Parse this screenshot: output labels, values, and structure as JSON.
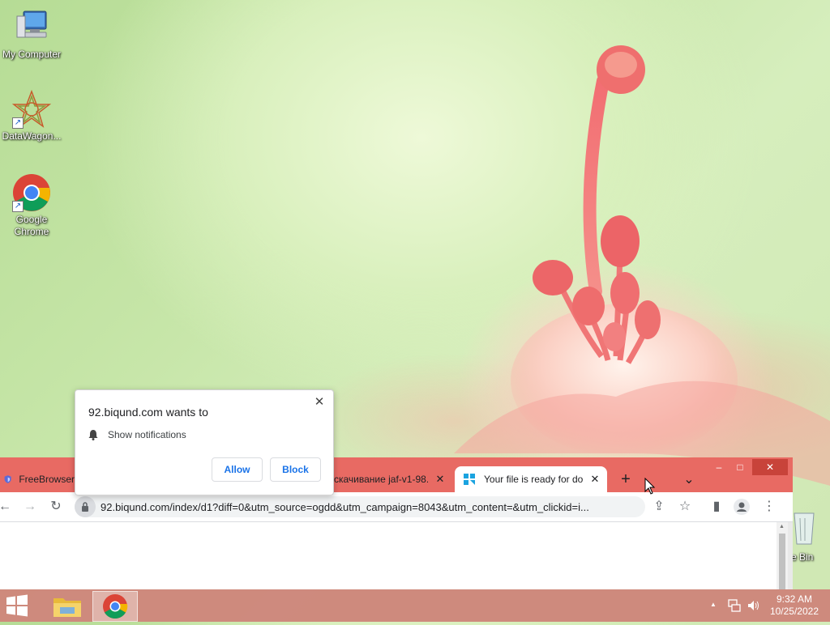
{
  "desktop": {
    "icons": [
      {
        "label": "My Computer",
        "icon": "computer-icon"
      },
      {
        "label": "DataWagon...",
        "icon": "datawagon-icon"
      },
      {
        "label": "Google Chrome",
        "icon": "chrome-icon"
      }
    ],
    "recycle_bin_partial_label": "e Bin"
  },
  "permission_popup": {
    "title": "92.biqund.com wants to",
    "request": "Show notifications",
    "allow_label": "Allow",
    "block_label": "Block",
    "close_glyph": "✕"
  },
  "browser": {
    "tabs": [
      {
        "title": "FreeBrowser",
        "icon": "shield-icon",
        "active": false
      },
      {
        "title": "скачивание jaf-v1-98.",
        "icon": null,
        "active": false
      },
      {
        "title": "Your file is ready for do",
        "icon": "file-icon",
        "active": true
      }
    ],
    "new_tab_glyph": "+",
    "tab_search_glyph": "⌄",
    "window_controls": {
      "minimize": "–",
      "maximize": "□",
      "close": "✕"
    },
    "url": "92.biqund.com/index/d1?diff=0&utm_source=ogdd&utm_campaign=8043&utm_content=&utm_clickid=i...",
    "nav": {
      "back": "←",
      "forward": "→",
      "reload": "↻"
    }
  },
  "taskbar": {
    "apps": [
      {
        "name": "file-explorer",
        "active": false
      },
      {
        "name": "chrome",
        "active": true
      }
    ],
    "clock": {
      "time": "9:32 AM",
      "date": "10/25/2022"
    },
    "tray_glyphs": {
      "expand": "▲",
      "network": "🖧",
      "volume": "🔊"
    }
  },
  "colors": {
    "accent_tabstrip": "#e86a63",
    "taskbar": "#cd8278",
    "link_blue": "#1a73e8"
  }
}
